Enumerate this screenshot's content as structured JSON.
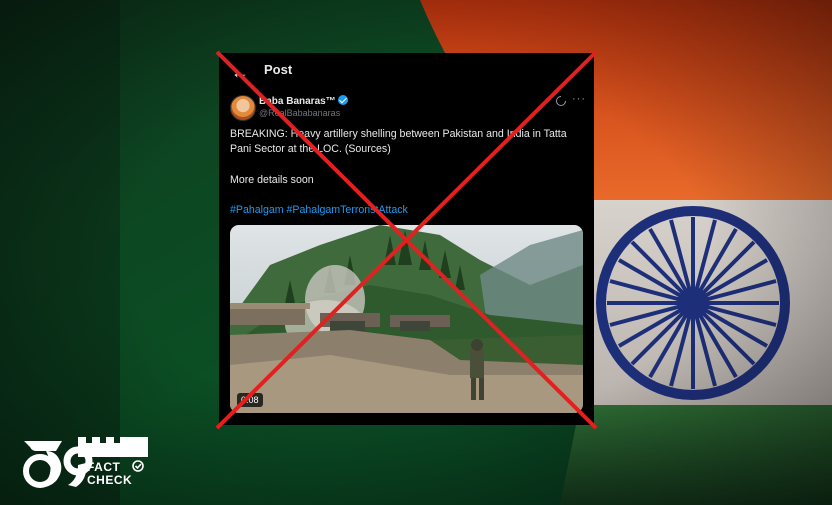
{
  "post": {
    "header_title": "Post",
    "author_name": "Baba Banaras™",
    "author_handle": "@RealBababanaras",
    "text_line1": "BREAKING: Heavy artillery shelling between Pakistan and India in Tatta Pani Sector at the LOC. (Sources)",
    "text_line2": "More details soon",
    "hashtags": "#Pahalgam #PahalgamTerroristAttack",
    "video_duration": "0:08"
  },
  "logo": {
    "number": "79",
    "word1": "FACT",
    "word2": "CHECK"
  },
  "colors": {
    "pakistan_green": "#0b4a22",
    "india_saffron": "#e0541c",
    "india_green": "#1f5a2a",
    "chakra_blue": "#1e2f7a",
    "cross_red": "#e32020",
    "link_blue": "#1d9bf0"
  },
  "icons": [
    "back-arrow-icon",
    "verified-badge-icon",
    "grok-icon",
    "more-options-icon",
    "check-circle-icon"
  ]
}
